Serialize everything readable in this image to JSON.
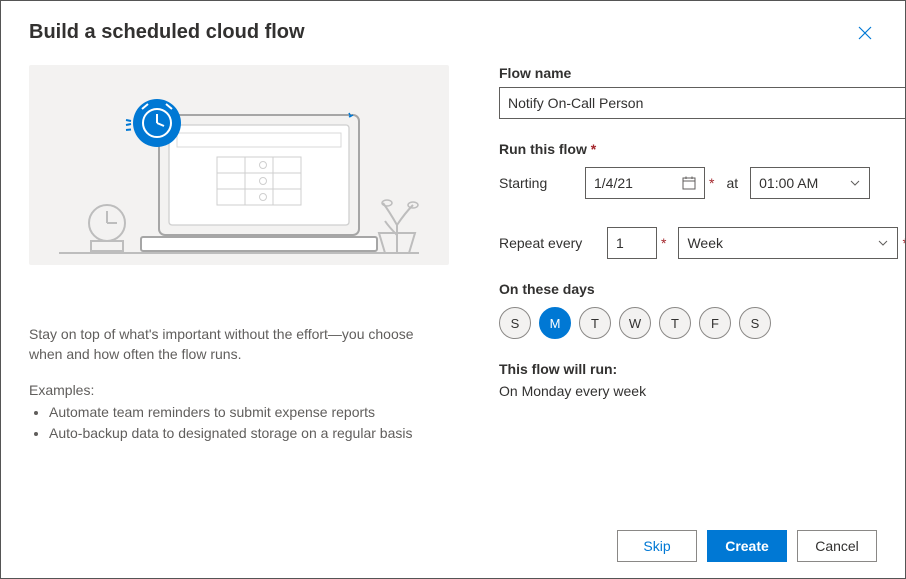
{
  "header": {
    "title": "Build a scheduled cloud flow"
  },
  "left": {
    "description": "Stay on top of what's important without the effort—you choose when and how often the flow runs.",
    "examples_label": "Examples:",
    "examples": [
      "Automate team reminders to submit expense reports",
      "Auto-backup data to designated storage on a regular basis"
    ]
  },
  "form": {
    "flow_name_label": "Flow name",
    "flow_name_value": "Notify On-Call Person",
    "run_label": "Run this flow",
    "starting_label": "Starting",
    "starting_value": "1/4/21",
    "at_label": "at",
    "time_value": "01:00 AM",
    "repeat_label": "Repeat every",
    "repeat_n": "1",
    "repeat_unit": "Week",
    "days_label": "On these days",
    "days": [
      "S",
      "M",
      "T",
      "W",
      "T",
      "F",
      "S"
    ],
    "days_selected_index": 1,
    "summary_label": "This flow will run:",
    "summary_value": "On Monday every week"
  },
  "footer": {
    "skip": "Skip",
    "create": "Create",
    "cancel": "Cancel"
  }
}
